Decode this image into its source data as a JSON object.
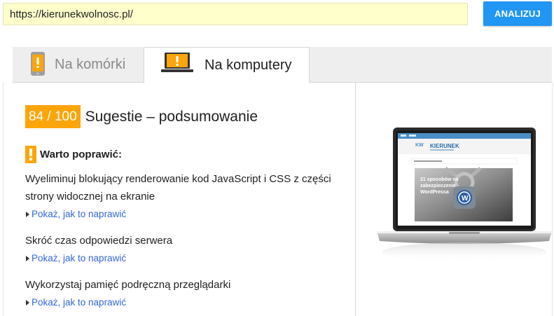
{
  "url_bar": {
    "value": "https://kierunekwolnosc.pl/",
    "button_label": "ANALIZUJ"
  },
  "tabs": [
    {
      "label": "Na komórki",
      "active": false,
      "icon": "phone-warning-icon"
    },
    {
      "label": "Na komputery",
      "active": true,
      "icon": "laptop-warning-icon"
    }
  ],
  "summary": {
    "score": "84 / 100",
    "title": "Sugestie – podsumowanie"
  },
  "section": {
    "warning_mark": "!",
    "heading": "Warto poprawić:"
  },
  "rules": [
    {
      "text": "Wyeliminuj blokujący renderowanie kod JavaScript i CSS z części strony widocznej na ekranie",
      "link": "Pokaż, jak to naprawić"
    },
    {
      "text": "Skróć czas odpowiedzi serwera",
      "link": "Pokaż, jak to naprawić"
    },
    {
      "text": "Wykorzystaj pamięć podręczną przeglądarki",
      "link": "Pokaż, jak to naprawić"
    }
  ],
  "preview": {
    "logo_text": "KIERUNEK",
    "headline_line1": "21 sposobów na",
    "headline_line2": "zabezpieczenie",
    "headline_line3": "WordPressa"
  },
  "colors": {
    "accent_orange": "#fca50a",
    "button_blue": "#2196f3",
    "link_blue": "#3367d6",
    "url_bg": "#ffffcc"
  }
}
